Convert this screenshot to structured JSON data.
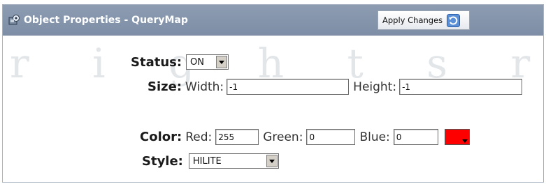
{
  "window": {
    "title": "Object Properties - QueryMap",
    "title_icon": "object-properties-icon",
    "apply_button_label": "Apply Changes",
    "apply_button_icon": "apply-refresh-icon"
  },
  "watermark": {
    "text": "r i g h t s   r e s e r"
  },
  "form": {
    "status": {
      "label": "Status:",
      "value": "ON"
    },
    "size": {
      "label": "Size:",
      "width_label": "Width:",
      "width_value": "-1",
      "height_label": "Height:",
      "height_value": "-1"
    },
    "color": {
      "label": "Color:",
      "red_label": "Red:",
      "red_value": "255",
      "green_label": "Green:",
      "green_value": "0",
      "blue_label": "Blue:",
      "blue_value": "0",
      "swatch_color": "#ff0000"
    },
    "style": {
      "label": "Style:",
      "value": "HILITE"
    }
  }
}
